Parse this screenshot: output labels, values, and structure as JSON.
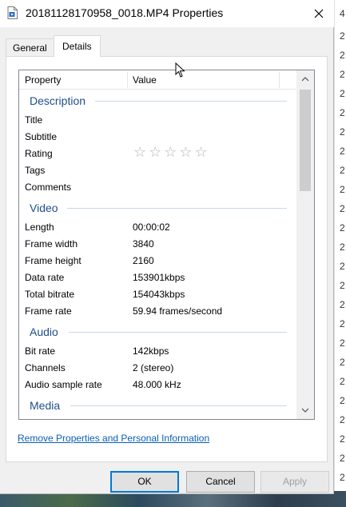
{
  "window": {
    "title": "20181128170958_0018.MP4 Properties",
    "close_glyph": "✕"
  },
  "tabs": [
    {
      "label": "General",
      "selected": false
    },
    {
      "label": "Details",
      "selected": true
    }
  ],
  "list": {
    "header_property": "Property",
    "header_value": "Value",
    "sections": {
      "description": {
        "title": "Description",
        "rows": [
          {
            "prop": "Title",
            "val": ""
          },
          {
            "prop": "Subtitle",
            "val": ""
          },
          {
            "prop": "Rating",
            "val": ""
          },
          {
            "prop": "Tags",
            "val": ""
          },
          {
            "prop": "Comments",
            "val": ""
          }
        ],
        "rating_stars": "☆☆☆☆☆"
      },
      "video": {
        "title": "Video",
        "rows": [
          {
            "prop": "Length",
            "val": "00:00:02"
          },
          {
            "prop": "Frame width",
            "val": "3840"
          },
          {
            "prop": "Frame height",
            "val": "2160"
          },
          {
            "prop": "Data rate",
            "val": "153901kbps"
          },
          {
            "prop": "Total bitrate",
            "val": "154043kbps"
          },
          {
            "prop": "Frame rate",
            "val": "59.94 frames/second"
          }
        ]
      },
      "audio": {
        "title": "Audio",
        "rows": [
          {
            "prop": "Bit rate",
            "val": "142kbps"
          },
          {
            "prop": "Channels",
            "val": "2 (stereo)"
          },
          {
            "prop": "Audio sample rate",
            "val": "48.000 kHz"
          }
        ]
      },
      "media": {
        "title": "Media"
      }
    }
  },
  "links": {
    "remove_properties": "Remove Properties and Personal Information"
  },
  "buttons": {
    "ok": "OK",
    "cancel": "Cancel",
    "apply": "Apply"
  },
  "background_window": {
    "chars": [
      "4",
      "2",
      "2",
      "2",
      "2",
      "2",
      "2",
      "2",
      "2",
      "2",
      "2",
      "2",
      "2",
      "2",
      "2",
      "2",
      "2",
      "2",
      "2",
      "2",
      "2",
      "2",
      "2",
      "2",
      "2",
      "2",
      "2"
    ]
  },
  "colors": {
    "accent": "#0078d7",
    "section_heading": "#1e4e8c",
    "link": "#0a5fb4"
  }
}
